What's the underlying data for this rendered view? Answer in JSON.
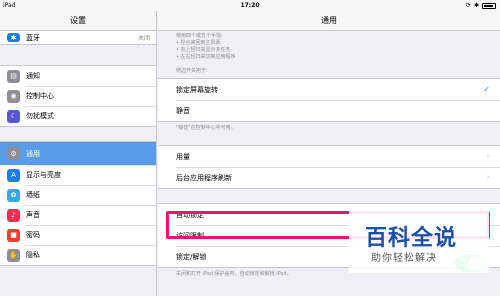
{
  "status_bar": {
    "device": "iPad",
    "time": "17:20"
  },
  "sidebar": {
    "title": "设置",
    "top_items": [
      {
        "label": "蓝牙",
        "value": "关闭",
        "icon": "bluetooth-icon",
        "color": "#1a7cf5"
      }
    ],
    "group1": [
      {
        "label": "通知",
        "icon": "notifications-icon",
        "color": "#8e8e93"
      },
      {
        "label": "控制中心",
        "icon": "control-center-icon",
        "color": "#8e8e93"
      },
      {
        "label": "勿扰模式",
        "icon": "moon-icon",
        "color": "#5856d6"
      }
    ],
    "group2": [
      {
        "label": "通用",
        "icon": "gear-icon",
        "color": "#8e8e93",
        "selected": true
      },
      {
        "label": "显示与亮度",
        "icon": "display-icon",
        "color": "#1a7cf5"
      },
      {
        "label": "墙纸",
        "icon": "wallpaper-icon",
        "color": "#34aadc"
      },
      {
        "label": "声音",
        "icon": "sound-icon",
        "color": "#ff2d55"
      },
      {
        "label": "密码",
        "icon": "lock-icon",
        "color": "#ff3b30"
      },
      {
        "label": "隐私",
        "icon": "hand-icon",
        "color": "#8e8e93"
      }
    ]
  },
  "detail": {
    "title": "通用",
    "top_note": [
      "使用四个或五个手指:",
      "• 捏合来回到主屏幕",
      "• 向上轻扫来显示多任务",
      "• 左右轻扫来切换应用程序"
    ],
    "side_switch_header": "侧边开关用于:",
    "side_switch_options": [
      {
        "label": "锁定屏幕旋转",
        "checked": true
      },
      {
        "label": "静音",
        "checked": false
      }
    ],
    "side_switch_note": "\"静音\"在控制中心中可用。",
    "group_usage": [
      {
        "label": "用量"
      },
      {
        "label": "后台应用程序刷新"
      }
    ],
    "group_lock": [
      {
        "label": "自动锁定"
      },
      {
        "label": "访问限制"
      },
      {
        "label": "锁定/解锁"
      }
    ],
    "bottom_note": "关闭和打开 iPad 保护盖时，自动锁定和解锁 iPad。"
  },
  "watermark": {
    "title": "百科全说",
    "subtitle": "助你轻松解决",
    "color": "#1b4fa3"
  },
  "accent_colors": {
    "selected_row": "#5b9ce8",
    "highlight_border": "#e5176d",
    "toggle_on": "#4cd964",
    "check": "#1a7cf5"
  }
}
